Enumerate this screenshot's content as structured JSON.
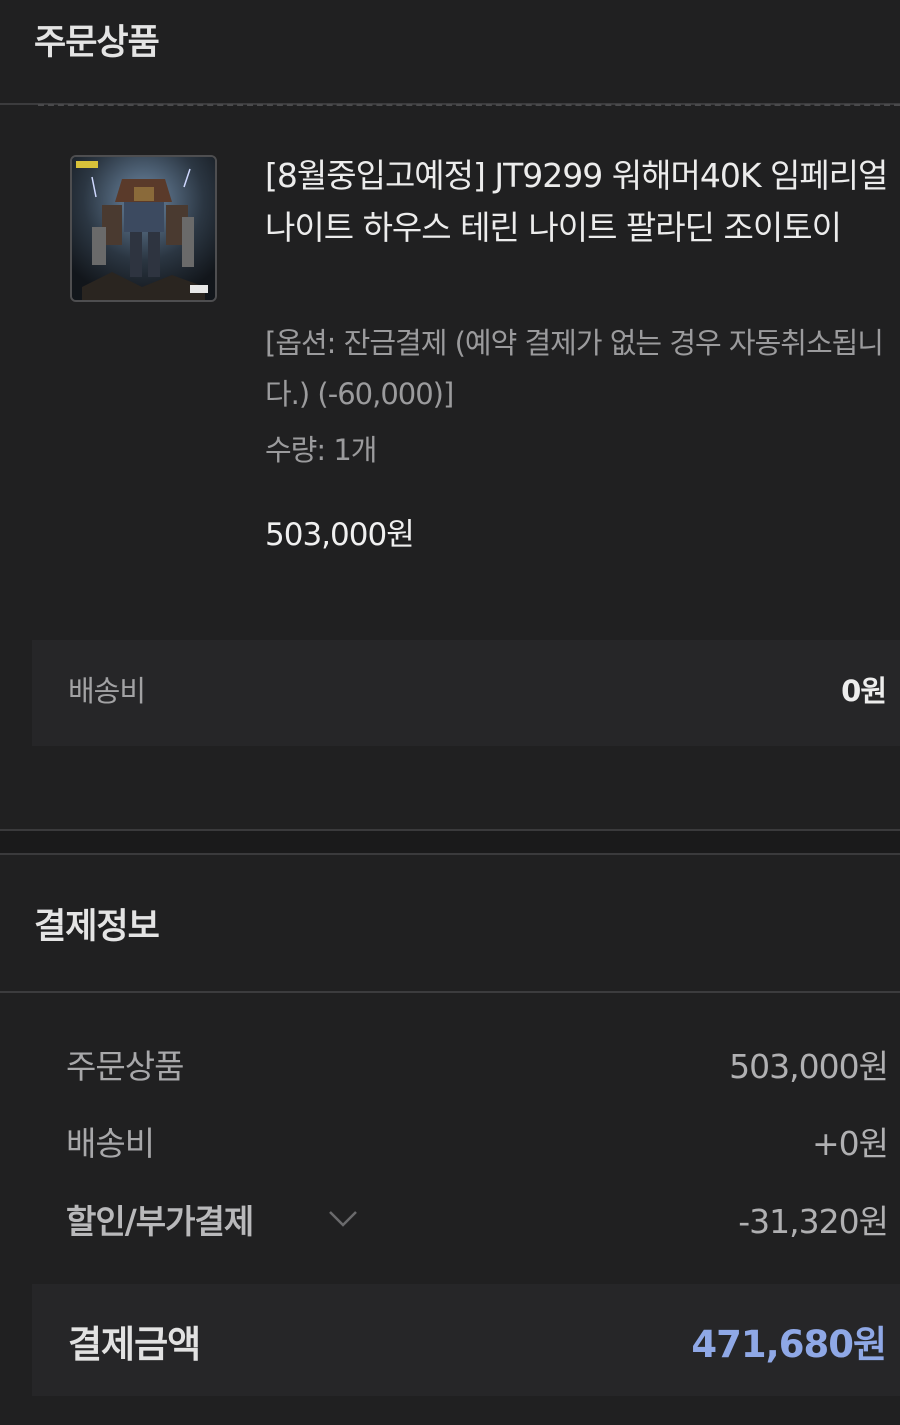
{
  "order_section": {
    "title": "주문상품"
  },
  "product": {
    "thumbnail_icon": "product-thumbnail-image",
    "name": "[8월중입고예정] JT9299 워해머40K 임페리얼 나이트 하우스 테린 나이트 팔라딘 조이토이",
    "option": "[옵션: 잔금결제 (예약 결제가 없는 경우 자동취소됩니다.) (-60,000)]",
    "quantity": "수량: 1개",
    "price": "503,000원"
  },
  "shipping": {
    "label": "배송비",
    "value": "0원"
  },
  "payment_section": {
    "title": "결제정보",
    "rows": [
      {
        "label": "주문상품",
        "value": "503,000원"
      },
      {
        "label": "배송비",
        "value": "+0원"
      },
      {
        "label": "할인/부가결제",
        "value": "-31,320원",
        "icon": "chevron-down-icon"
      }
    ],
    "total_label": "결제금액",
    "total_value": "471,680원"
  },
  "colors": {
    "background": "#202021",
    "panel": "#262628",
    "accent_total": "#8fa8e6"
  }
}
